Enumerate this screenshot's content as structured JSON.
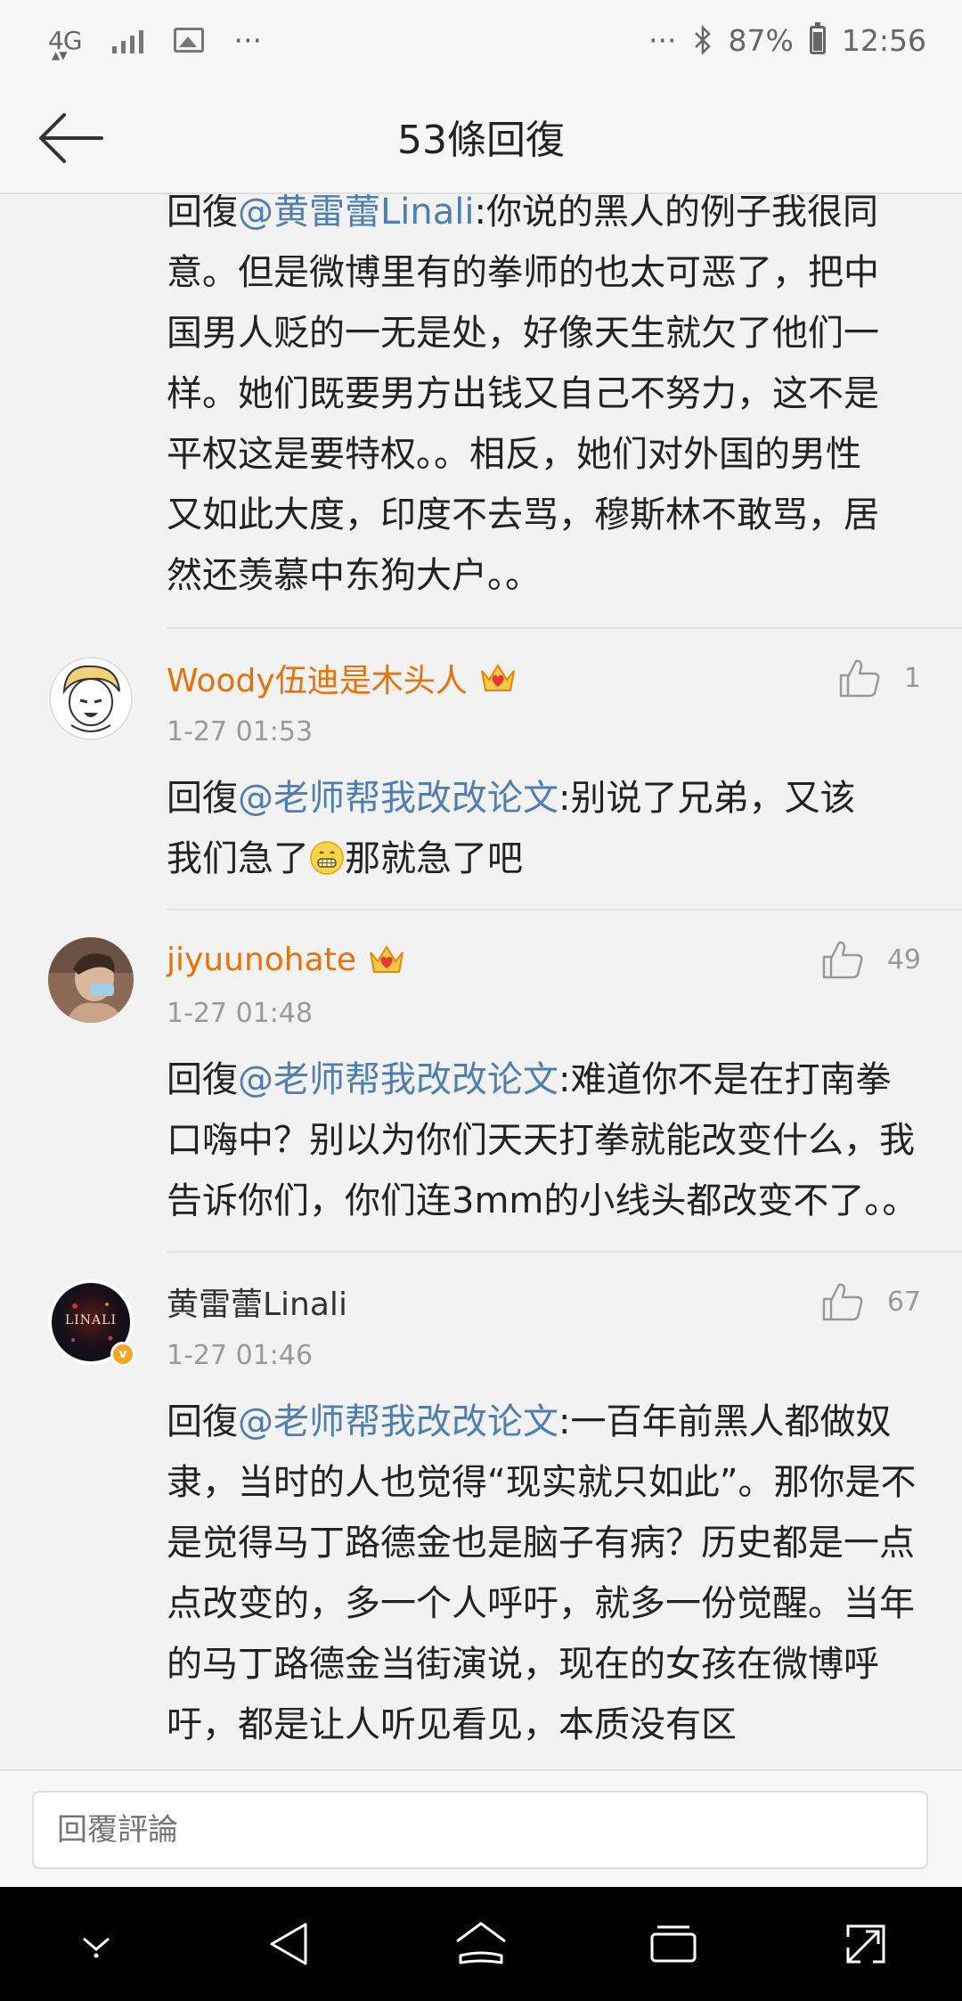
{
  "status_bar": {
    "network": "4G",
    "overflow_left": "···",
    "overflow_right": "···",
    "battery": "87%",
    "time": "12:56"
  },
  "header": {
    "title": "53條回復",
    "back_icon": "arrow-left-icon"
  },
  "partial_comment": {
    "text_lines": [
      "意。但是微博里有的拳师的也太可恶了，把中",
      "国男人贬的一无是处，好像天生就欠了他们一",
      "样。她们既要男方出钱又自己不努力，这不是",
      "平权这是要特权。。相反，她们对外国的男性",
      "又如此大度，印度不去骂，穆斯林不敢骂，居",
      "然还羡慕中东狗大户。。"
    ],
    "first_line_reply": "回復",
    "first_line_mention": "@黄雷蕾Linali",
    "first_line_rest": ":你说的黑人的例子我很同"
  },
  "comments": [
    {
      "username": "Woody伍迪是木头人",
      "has_crown": true,
      "likes": "1",
      "time": "1-27 01:53",
      "reply_prefix": "回復",
      "mention": "@老师帮我改改论文",
      "text_a": ":别说了兄弟，又该",
      "text_b": "我们急了",
      "text_c": "那就急了吧"
    },
    {
      "username": "jiyuunohate",
      "has_crown": true,
      "likes": "49",
      "time": "1-27 01:48",
      "reply_prefix": "回復",
      "mention": "@老师帮我改改论文",
      "text": ":难道你不是在打南拳口嗨中？别以为你们天天打拳就能改变什么，我告诉你们，你们连3mm的小线头都改变不了。。"
    },
    {
      "username": "黄雷蕾Linali",
      "has_crown": false,
      "verified": true,
      "avatar_text": "LINALI",
      "likes": "67",
      "time": "1-27 01:46",
      "reply_prefix": "回復",
      "mention": "@老师帮我改改论文",
      "text": ":一百年前黑人都做奴隶，当时的人也觉得“现实就只如此”。那你是不是觉得马丁路德金也是脑子有病？历史都是一点点改变的，多一个人呼吁，就多一份觉醒。当年的马丁路德金当街演说，现在的女孩在微博呼吁，都是让人听见看见，本质没有区"
    }
  ],
  "reply_bar": {
    "placeholder": "回覆評論"
  },
  "colors": {
    "accent_orange": "#e8710a",
    "mention_blue": "#4d7fb3",
    "badge_gold": "#f5a623"
  }
}
